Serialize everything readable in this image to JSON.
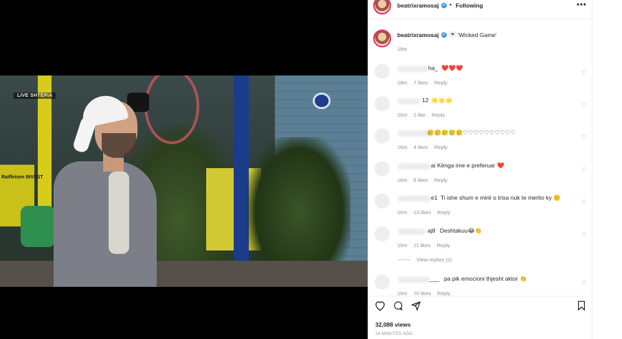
{
  "video": {
    "overlay_label": "LIVE SHTËPIA",
    "brand_text": "Raiffeisen INVEST"
  },
  "header": {
    "username": "beatrixramosaj",
    "verified_mark": "✔",
    "separator": "•",
    "follow_status": "Following",
    "more_label": "•••"
  },
  "caption": {
    "username": "beatrixramosaj",
    "envelope_emoji": "💌",
    "text": "'Wicked Game'",
    "time": "18m"
  },
  "comments": [
    {
      "user_suffix": "ha_",
      "text": "❤️❤️❤️",
      "time": "18m",
      "likes": "7 likes",
      "reply": "Reply"
    },
    {
      "user_suffix": "12",
      "text": "🌟🌟🌟",
      "time": "16m",
      "likes": "1 like",
      "reply": "Reply"
    },
    {
      "user_suffix": "",
      "text": "🥲🥲🥲🥲🥲♡♡♡♡♡♡♡♡♡♡",
      "time": "16m",
      "likes": "4 likes",
      "reply": "Reply"
    },
    {
      "user_suffix": "ai",
      "text": "Kënga ime e preferuar ❤️",
      "time": "16m",
      "likes": "8 likes",
      "reply": "Reply"
    },
    {
      "user_suffix": "e1",
      "text": "Ti ishe shum e mirë o trixa nuk te merito ky 🙂",
      "time": "16m",
      "likes": "13 likes",
      "reply": "Reply"
    },
    {
      "user_suffix": "aj8",
      "text": "Deshtakuu😂👏",
      "time": "16m",
      "likes": "11 likes",
      "reply": "Reply"
    },
    {
      "user_suffix": "___",
      "text": "pa pik emocioni thjesht aktor 👏",
      "time": "16m",
      "likes": "70 likes",
      "reply": "Reply"
    }
  ],
  "view_replies": "View replies (2)",
  "footer": {
    "views": "32,088 views",
    "posted": "18 MINUTES AGO"
  },
  "icons": {
    "like": "heart-outline-icon",
    "comment": "comment-bubble-icon",
    "share": "paper-plane-icon",
    "save": "bookmark-icon"
  }
}
